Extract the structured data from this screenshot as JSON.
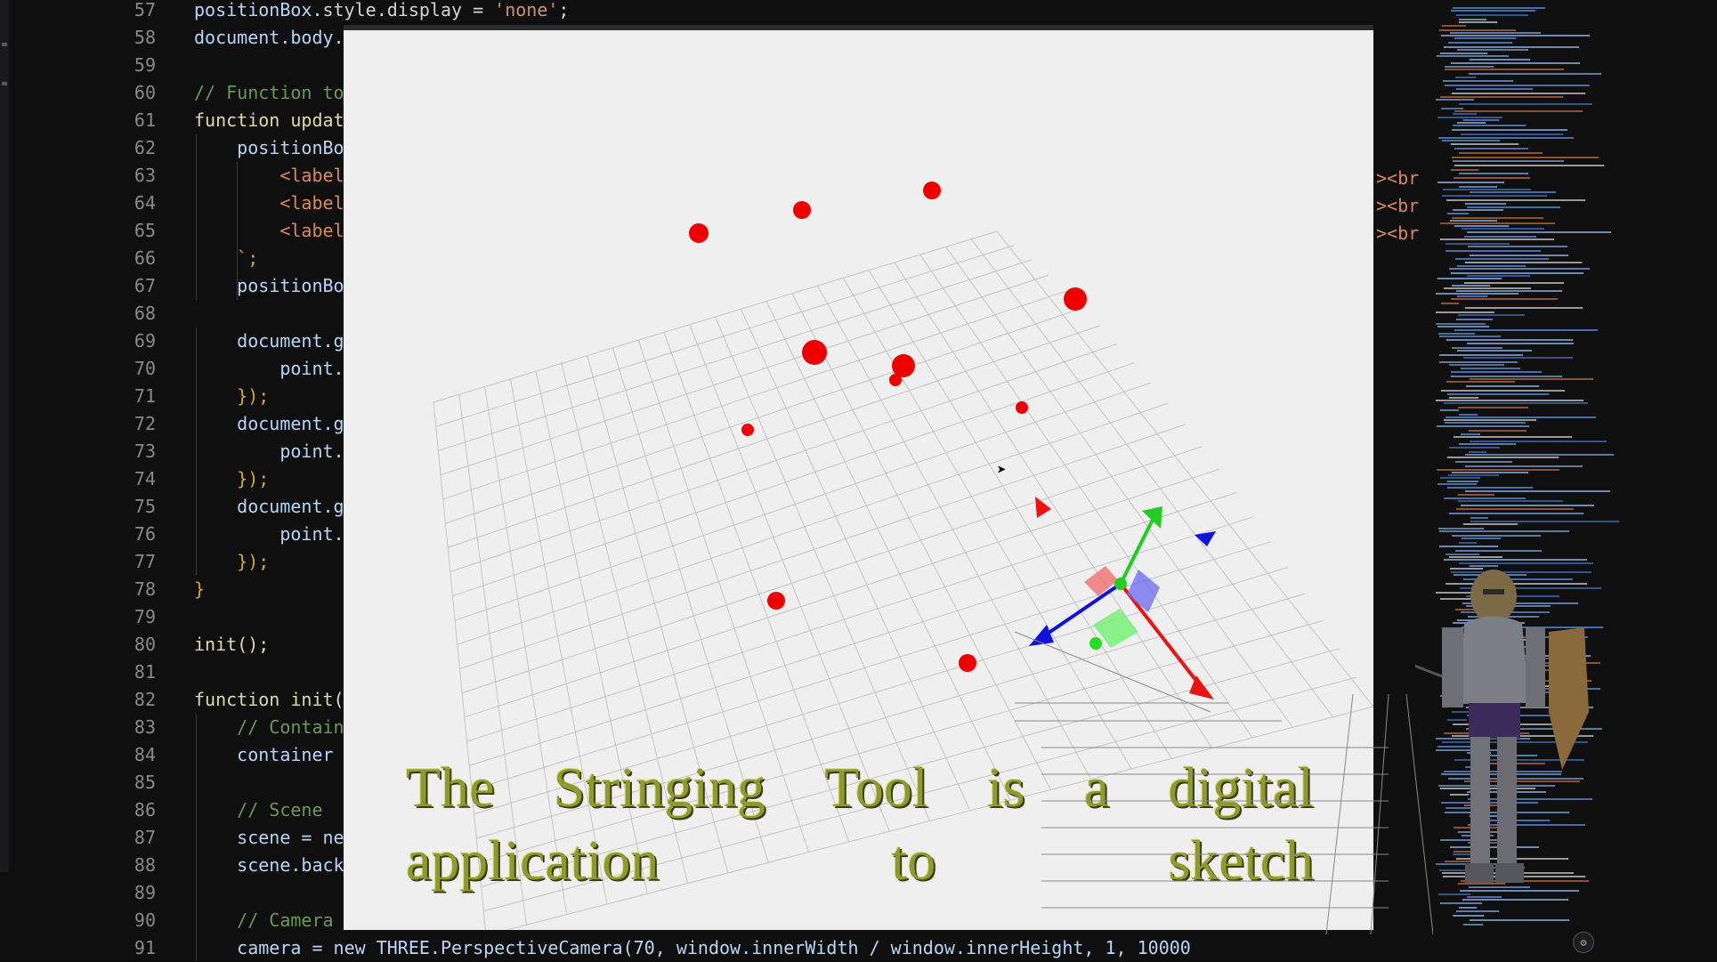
{
  "editor": {
    "line_numbers": [
      "57",
      "58",
      "59",
      "60",
      "61",
      "62",
      "63",
      "64",
      "65",
      "66",
      "67",
      "68",
      "69",
      "70",
      "71",
      "72",
      "73",
      "74",
      "75",
      "76",
      "77",
      "78",
      "79",
      "80",
      "81",
      "82",
      "83",
      "84",
      "85",
      "86",
      "87",
      "88",
      "89",
      "90",
      "91"
    ],
    "lines": [
      [
        "positionBox",
        ".style.display = ",
        "'none'",
        ";"
      ],
      [
        "document.body."
      ],
      [
        ""
      ],
      [
        "// Function to"
      ],
      [
        "function updat"
      ],
      [
        "    positionBo"
      ],
      [
        "        <label"
      ],
      [
        "        <label"
      ],
      [
        "        <label"
      ],
      [
        "    `;"
      ],
      [
        "    positionBo"
      ],
      [
        ""
      ],
      [
        "    document.g"
      ],
      [
        "        point."
      ],
      [
        "    });"
      ],
      [
        "    document.g"
      ],
      [
        "        point."
      ],
      [
        "    });"
      ],
      [
        "    document.g"
      ],
      [
        "        point."
      ],
      [
        "    });"
      ],
      [
        "}"
      ],
      [
        ""
      ],
      [
        "init();"
      ],
      [
        ""
      ],
      [
        "function init("
      ],
      [
        "    // Contain"
      ],
      [
        "    container"
      ],
      [
        ""
      ],
      [
        "    // Scene"
      ],
      [
        "    scene = ne"
      ],
      [
        "    scene.back"
      ],
      [
        ""
      ],
      [
        "    // Camera"
      ],
      [
        "    camera = new THREE.PerspectiveCamera(70, window.innerWidth / window.innerHeight, 1, 10000);"
      ]
    ],
    "right_fragments": [
      "><br",
      "><br",
      "><br"
    ]
  },
  "caption": {
    "line1": [
      "The",
      "Stringing",
      "Tool",
      "is",
      "a",
      "digital"
    ],
    "line2": [
      "application",
      "to",
      "sketch"
    ]
  },
  "colors": {
    "point": "#ee0000",
    "axis_x": "#ee1111",
    "axis_y": "#22cc22",
    "axis_z": "#1111dd",
    "viewport_bg": "#efefef",
    "caption": "#8c9a2e"
  },
  "icons": {
    "cursor": "mouse-pointer-icon",
    "gizmo": "transform-gizmo-icon",
    "knight": "knight-model-icon",
    "settings": "settings-icon"
  }
}
